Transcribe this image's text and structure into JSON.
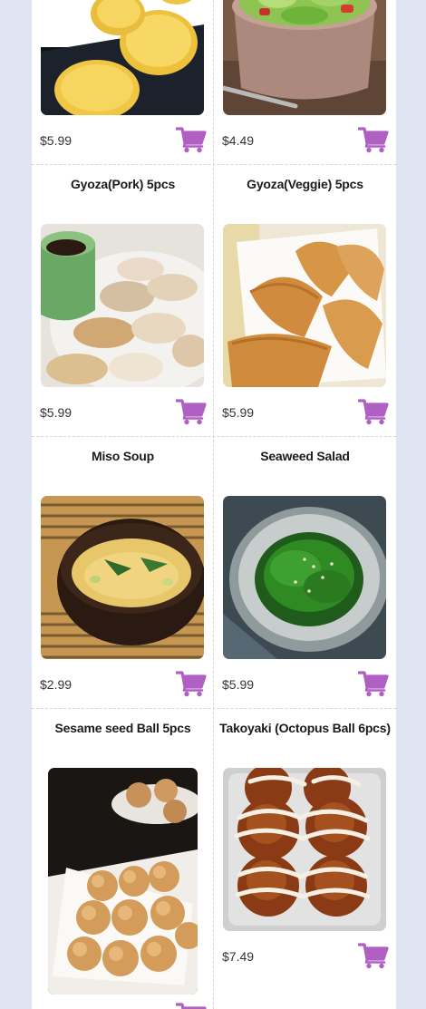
{
  "colors": {
    "page_background": "#dfe4f2",
    "card_background": "#ffffff",
    "cart_icon": "#b05fc2",
    "divider": "#d7d7d7"
  },
  "menu": {
    "items": [
      {
        "name": "",
        "price": "$5.99",
        "image": "fried-croquettes-photo",
        "cart_icon": "shopping-cart-icon"
      },
      {
        "name": "",
        "price": "$4.49",
        "image": "green-salad-photo",
        "cart_icon": "shopping-cart-icon"
      },
      {
        "name": "Gyoza(Pork) 5pcs",
        "price": "$5.99",
        "image": "pork-gyoza-photo",
        "cart_icon": "shopping-cart-icon"
      },
      {
        "name": "Gyoza(Veggie) 5pcs",
        "price": "$5.99",
        "image": "veggie-gyoza-photo",
        "cart_icon": "shopping-cart-icon"
      },
      {
        "name": "Miso Soup",
        "price": "$2.99",
        "image": "miso-soup-photo",
        "cart_icon": "shopping-cart-icon"
      },
      {
        "name": "Seaweed Salad",
        "price": "$5.99",
        "image": "seaweed-salad-photo",
        "cart_icon": "shopping-cart-icon"
      },
      {
        "name": "Sesame seed Ball 5pcs",
        "price": "",
        "image": "sesame-ball-photo",
        "cart_icon": "shopping-cart-icon"
      },
      {
        "name": "Takoyaki (Octopus Ball 6pcs)",
        "price": "$7.49",
        "image": "takoyaki-photo",
        "cart_icon": "shopping-cart-icon"
      }
    ]
  }
}
